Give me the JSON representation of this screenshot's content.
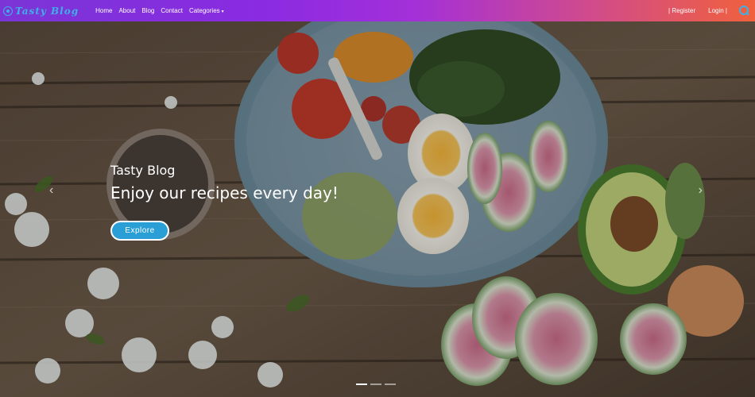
{
  "navbar": {
    "brand": "Tasty Blog",
    "links": [
      "Home",
      "About",
      "Blog",
      "Contact"
    ],
    "categories": "Categories",
    "register": "| Register",
    "login": "Login |"
  },
  "hero": {
    "subtitle": "Tasty Blog",
    "title": "Enjoy our recipes every day!",
    "button": "Explore",
    "prev_icon": "chevron-left-icon",
    "next_icon": "chevron-right-icon",
    "slides": 3,
    "active_slide": 1
  },
  "colors": {
    "accent": "#2a9fd6",
    "brand": "#3fb0e6",
    "nav_gradient_start": "#7b35d6",
    "nav_gradient_end": "#f0613c"
  }
}
